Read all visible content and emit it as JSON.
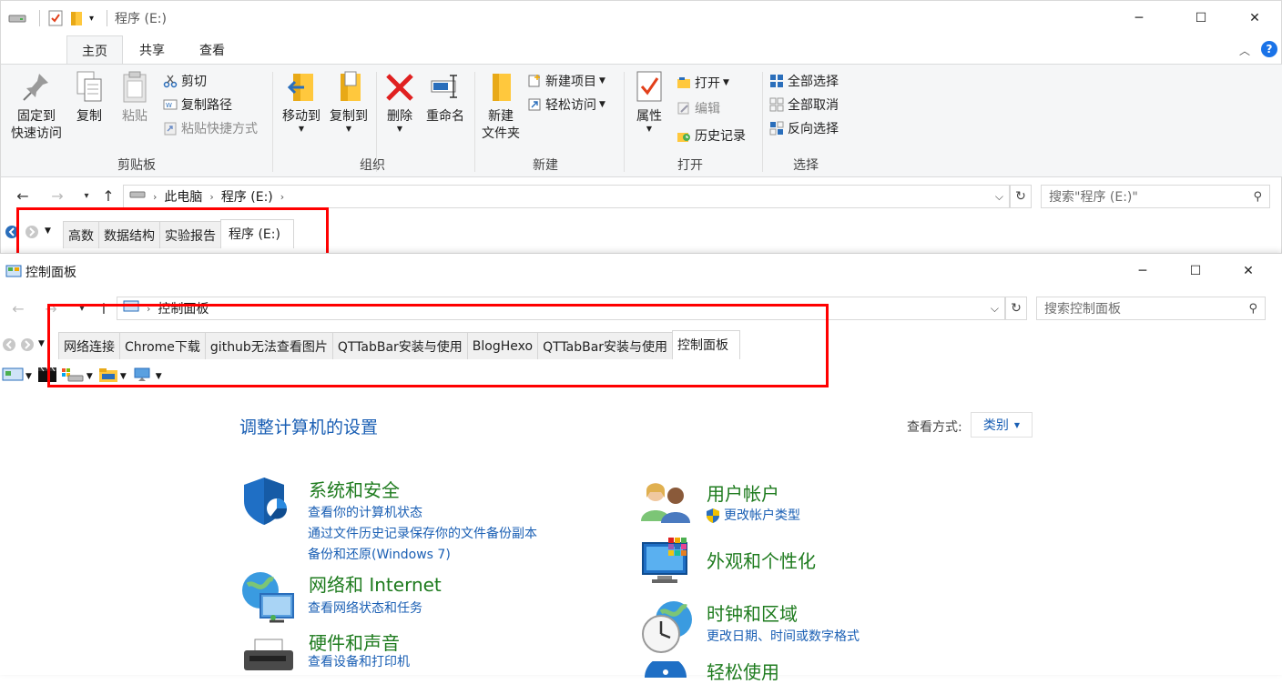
{
  "explorer": {
    "title": "程序 (E:)",
    "tabs": [
      "主页",
      "共享",
      "查看"
    ],
    "ribbon": {
      "clipboard": {
        "pin_line1": "固定到",
        "pin_line2": "快速访问",
        "copy": "复制",
        "paste": "粘贴",
        "cut": "剪切",
        "copy_path": "复制路径",
        "paste_shortcut": "粘贴快捷方式",
        "group": "剪贴板"
      },
      "organize": {
        "move_to": "移动到",
        "copy_to": "复制到",
        "delete": "删除",
        "rename": "重命名",
        "group": "组织"
      },
      "new": {
        "new_folder_line1": "新建",
        "new_folder_line2": "文件夹",
        "new_item": "新建项目",
        "easy_access": "轻松访问",
        "group": "新建"
      },
      "open": {
        "properties": "属性",
        "open": "打开",
        "edit": "编辑",
        "history": "历史记录",
        "group": "打开"
      },
      "select": {
        "select_all": "全部选择",
        "select_none": "全部取消",
        "invert": "反向选择",
        "group": "选择"
      }
    },
    "breadcrumb": [
      "此电脑",
      "程序 (E:)"
    ],
    "search_placeholder": "搜索\"程序 (E:)\"",
    "qt_tabs": [
      "高数",
      "数据结构",
      "实验报告",
      "程序 (E:)"
    ]
  },
  "control_panel": {
    "title": "控制面板",
    "breadcrumb": "控制面板",
    "search_placeholder": "搜索控制面板",
    "qt_tabs": [
      "网络连接",
      "Chrome下载",
      "github无法查看图片",
      "QTTabBar安装与使用",
      "BlogHexo",
      "QTTabBar安装与使用",
      "控制面板"
    ],
    "heading": "调整计算机的设置",
    "view_by_label": "查看方式:",
    "view_by_value": "类别",
    "categories_left": [
      {
        "title": "系统和安全",
        "links": [
          "查看你的计算机状态",
          "通过文件历史记录保存你的文件备份副本",
          "备份和还原(Windows 7)"
        ]
      },
      {
        "title": "网络和 Internet",
        "links": [
          "查看网络状态和任务"
        ]
      },
      {
        "title": "硬件和声音",
        "links": [
          "查看设备和打印机"
        ]
      }
    ],
    "categories_right": [
      {
        "title": "用户帐户",
        "links": [
          "更改帐户类型"
        ]
      },
      {
        "title": "外观和个性化",
        "links": []
      },
      {
        "title": "时钟和区域",
        "links": [
          "更改日期、时间或数字格式"
        ]
      },
      {
        "title": "轻松使用",
        "links": []
      }
    ]
  },
  "colors": {
    "accent_red": "#ff0000",
    "link_blue": "#1a5fb4",
    "heading_green": "#1e7b1e",
    "heading_blue": "#1a5fb4"
  }
}
